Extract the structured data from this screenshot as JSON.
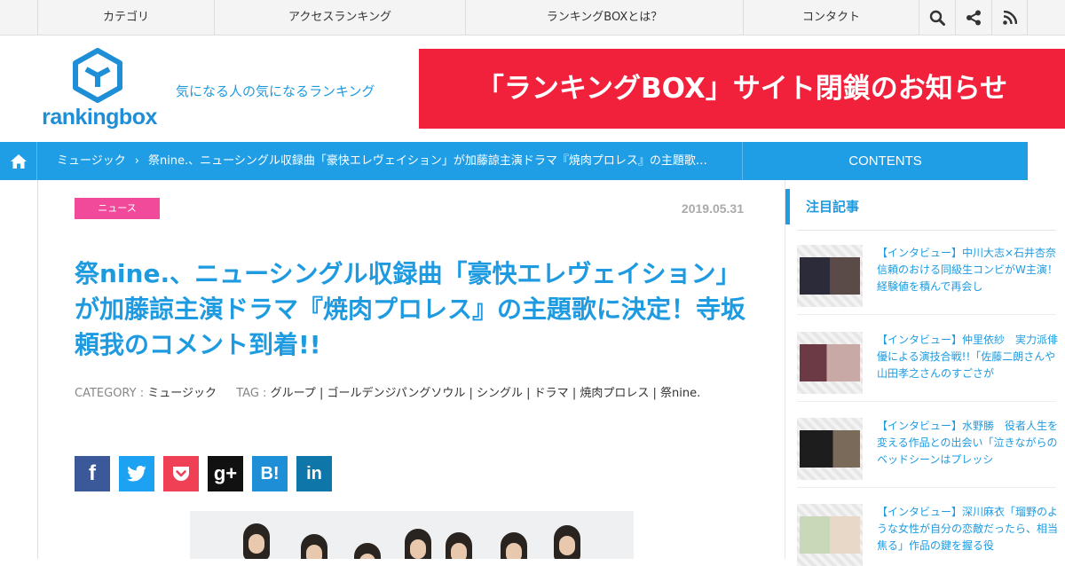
{
  "topnav": {
    "items": [
      "カテゴリ",
      "アクセスランキング",
      "ランキングBOXとは？",
      "コンタクト"
    ],
    "icons": [
      "search-icon",
      "share-icon",
      "rss-icon"
    ]
  },
  "header": {
    "logo_text": "rankingbox",
    "tagline": "気になる人の気になるランキング",
    "banner": "「ランキングBOX」サイト閉鎖のお知らせ"
  },
  "breadcrumb": {
    "category": "ミュージック",
    "current": "祭nine.、ニューシングル収録曲「豪快エレヴェイション」が加藤諒主演ドラマ『焼肉プロレス』の主題歌…",
    "separator": "›"
  },
  "contents_label": "CONTENTS",
  "article": {
    "badge": "ニュース",
    "date": "2019.05.31",
    "title": "祭nine.、ニューシングル収録曲「豪快エレヴェイション」が加藤諒主演ドラマ『焼肉プロレス』の主題歌に決定！寺坂頼我のコメント到着!!",
    "category_label": "CATEGORY :",
    "category": "ミュージック",
    "tag_label": "TAG :",
    "tags": [
      "グループ",
      "ゴールデンジパングソウル",
      "シングル",
      "ドラマ",
      "焼肉プロレス",
      "祭nine."
    ],
    "tag_separator": " | "
  },
  "share_buttons": [
    {
      "name": "facebook",
      "label": "f",
      "color": "#3b5998"
    },
    {
      "name": "twitter",
      "label": "",
      "color": "#1da1f2"
    },
    {
      "name": "pocket",
      "label": "",
      "color": "#ef4056"
    },
    {
      "name": "googleplus",
      "label": "g+",
      "color": "#111111"
    },
    {
      "name": "hatena",
      "label": "B!",
      "color": "#1e8fd6"
    },
    {
      "name": "linkedin",
      "label": "in",
      "color": "#0e76a8"
    }
  ],
  "sidebar": {
    "heading": "注目記事",
    "articles": [
      {
        "text": "【インタビュー】中川大志×石井杏奈　信頼のおける同級生コンビがW主演！経験値を積んで再会し"
      },
      {
        "text": "【インタビュー】仲里依紗　実力派俳優による演技合戦!!「佐藤二朗さんや山田孝之さんのすごさが"
      },
      {
        "text": "【インタビュー】水野勝　役者人生を変える作品との出会い「泣きながらのベッドシーンはプレッシ"
      },
      {
        "text": "【インタビュー】深川麻衣「瑠野のような女性が自分の恋敵だったら、相当焦る」作品の鍵を握る役"
      }
    ]
  },
  "colors": {
    "accent": "#1f9ee6",
    "banner": "#f2213b",
    "badge": "#f24a9a"
  }
}
